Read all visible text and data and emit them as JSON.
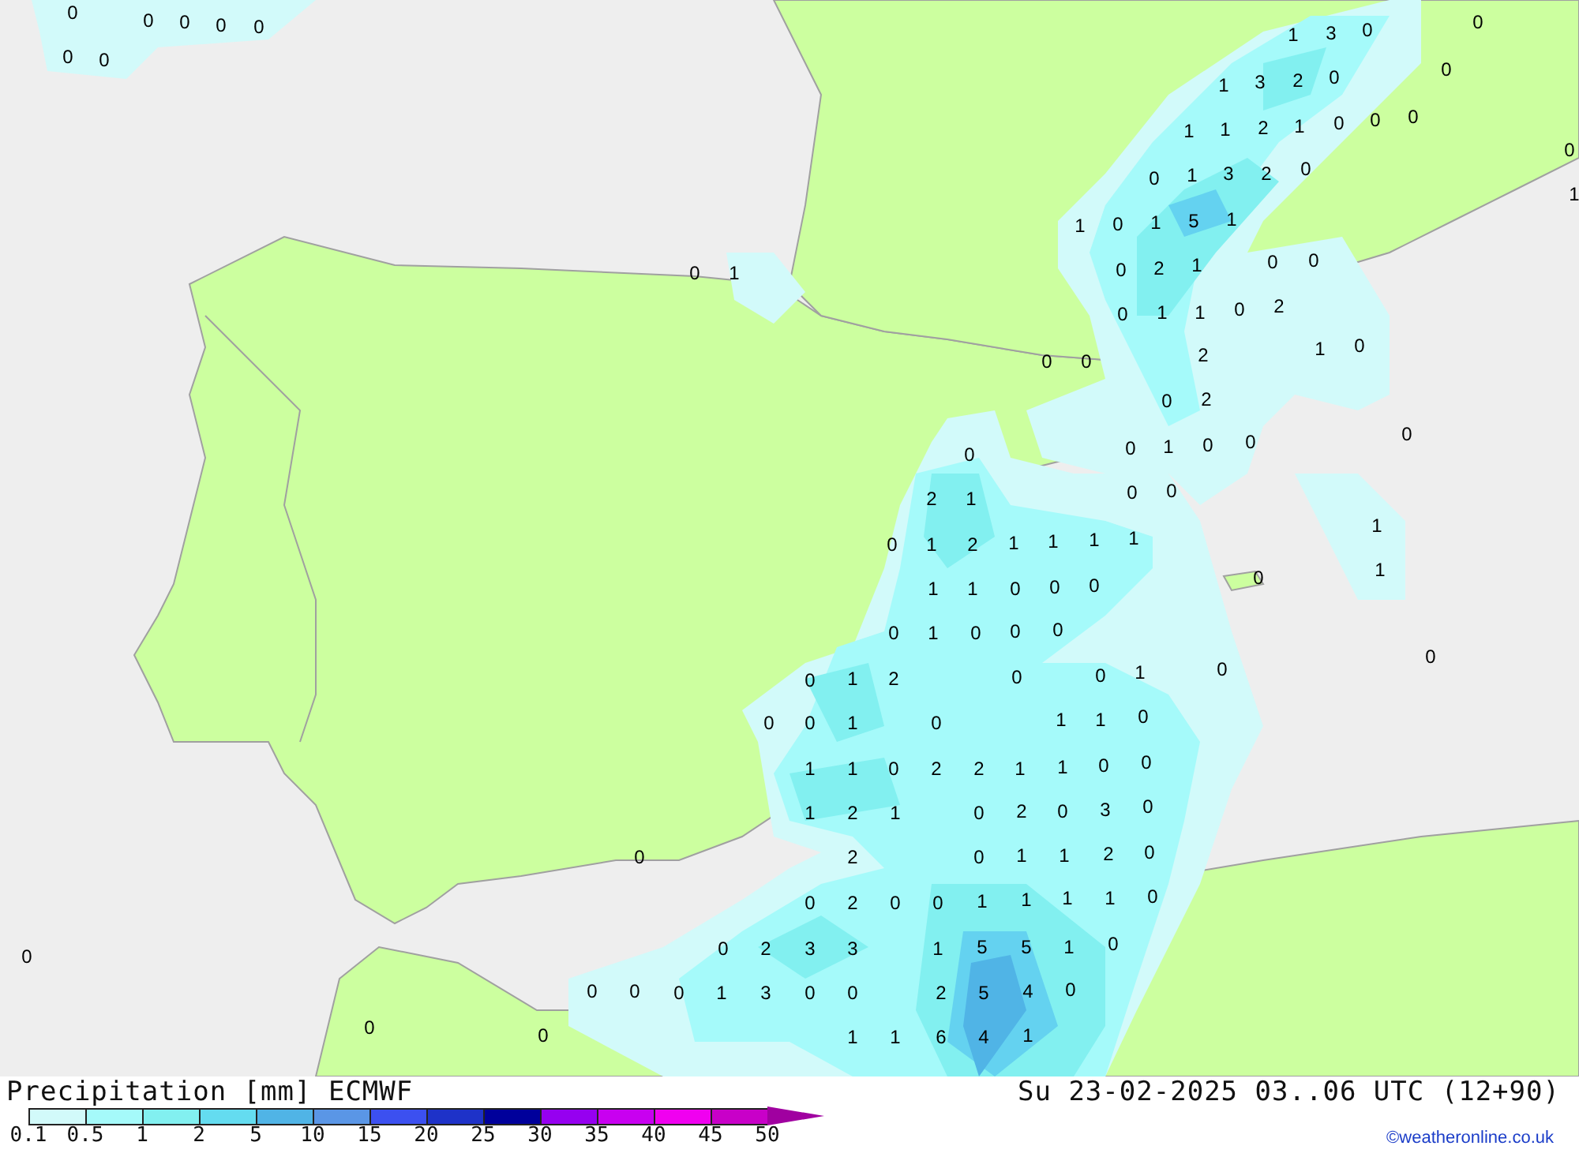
{
  "map": {
    "labels": [
      "0",
      "0",
      "0",
      "0",
      "0",
      "0",
      "0",
      "1",
      "3",
      "0",
      "0",
      "1",
      "3",
      "2",
      "0",
      "0",
      "1",
      "1",
      "2",
      "1",
      "0",
      "0",
      "0",
      "0",
      "1",
      "0",
      "1",
      "3",
      "2",
      "0",
      "1",
      "0",
      "1",
      "5",
      "1",
      "0",
      "1",
      "0",
      "2",
      "1",
      "0",
      "0",
      "0",
      "1",
      "1",
      "0",
      "2",
      "1",
      "0",
      "0",
      "0",
      "2",
      "0",
      "2",
      "0",
      "0",
      "1",
      "0",
      "0",
      "0",
      "0",
      "0",
      "2",
      "1",
      "1",
      "0",
      "1",
      "2",
      "1",
      "1",
      "1",
      "1",
      "1",
      "0",
      "1",
      "1",
      "0",
      "0",
      "0",
      "0",
      "1",
      "0",
      "0",
      "0",
      "0",
      "0",
      "0",
      "1",
      "2",
      "0",
      "0",
      "1",
      "0",
      "0",
      "1",
      "0",
      "1",
      "1",
      "0",
      "1",
      "1",
      "0",
      "2",
      "2",
      "1",
      "1",
      "0",
      "0",
      "1",
      "2",
      "1",
      "0",
      "2",
      "0",
      "3",
      "0",
      "0",
      "2",
      "0",
      "1",
      "1",
      "2",
      "0",
      "0",
      "2",
      "0",
      "0",
      "1",
      "1",
      "1",
      "1",
      "0",
      "0",
      "2",
      "3",
      "3",
      "1",
      "5",
      "5",
      "1",
      "0",
      "0",
      "0",
      "0",
      "0",
      "1",
      "3",
      "0",
      "0",
      "2",
      "5",
      "4",
      "0",
      "0",
      "0",
      "1",
      "1",
      "6",
      "4",
      "1"
    ]
  },
  "legend": {
    "title": "Precipitation [mm] ECMWF",
    "timestamp": "Su 23-02-2025 03..06 UTC (12+90)",
    "bins": [
      {
        "color": "#d2fafa"
      },
      {
        "color": "#a5fafa"
      },
      {
        "color": "#82f0f0"
      },
      {
        "color": "#64dcf0"
      },
      {
        "color": "#50b4e6"
      },
      {
        "color": "#5a96e6"
      },
      {
        "color": "#3c50f0"
      },
      {
        "color": "#1e32c8"
      },
      {
        "color": "#00009b"
      },
      {
        "color": "#9600f0"
      },
      {
        "color": "#c800f0"
      },
      {
        "color": "#f000f0"
      },
      {
        "color": "#c800c8"
      }
    ],
    "ticks": [
      "0.1",
      "0.5",
      "1",
      "2",
      "5",
      "10",
      "15",
      "20",
      "25",
      "30",
      "35",
      "40",
      "45",
      "50"
    ],
    "credit": "©weatheronline.co.uk"
  }
}
